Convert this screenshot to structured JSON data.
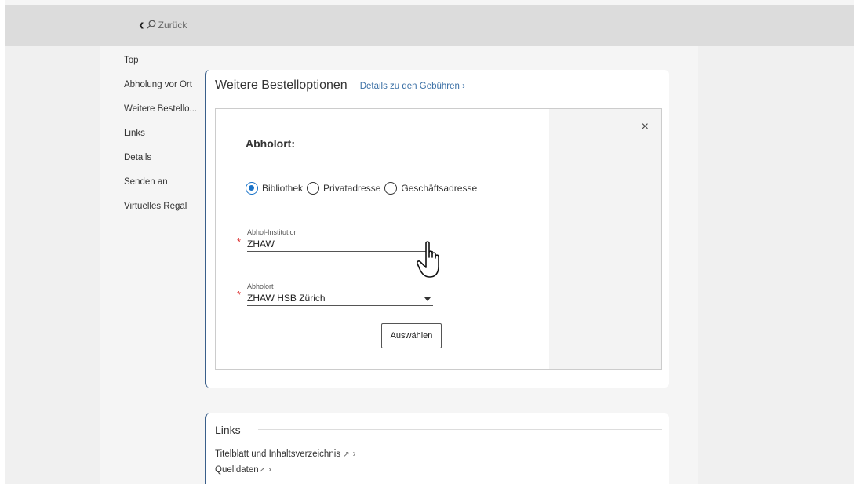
{
  "header": {
    "back_label": "Zurück"
  },
  "sidenav": {
    "items": [
      {
        "label": "Top"
      },
      {
        "label": "Abholung vor Ort"
      },
      {
        "label": "Weitere Bestello..."
      },
      {
        "label": "Links"
      },
      {
        "label": "Details"
      },
      {
        "label": "Senden an"
      },
      {
        "label": "Virtuelles Regal"
      }
    ]
  },
  "order_options": {
    "title": "Weitere Bestelloptionen",
    "fees_link": "Details zu den Gebühren",
    "dialog": {
      "heading": "Abholort:",
      "close": "×",
      "radios": [
        {
          "label": "Bibliothek",
          "checked": true
        },
        {
          "label": "Privatadresse",
          "checked": false
        },
        {
          "label": "Geschäftsadresse",
          "checked": false
        }
      ],
      "institution": {
        "label": "Abhol-Institution",
        "value": "ZHAW"
      },
      "location": {
        "label": "Abholort",
        "value": "ZHAW HSB Zürich"
      },
      "submit": "Auswählen"
    }
  },
  "links": {
    "title": "Links",
    "items": [
      {
        "label": "Titelblatt und Inhaltsverzeichnis"
      },
      {
        "label": "Quelldaten"
      }
    ]
  },
  "colors": {
    "accent": "#1a73c8",
    "link": "#3a6fa5",
    "required": "#dd3333"
  }
}
